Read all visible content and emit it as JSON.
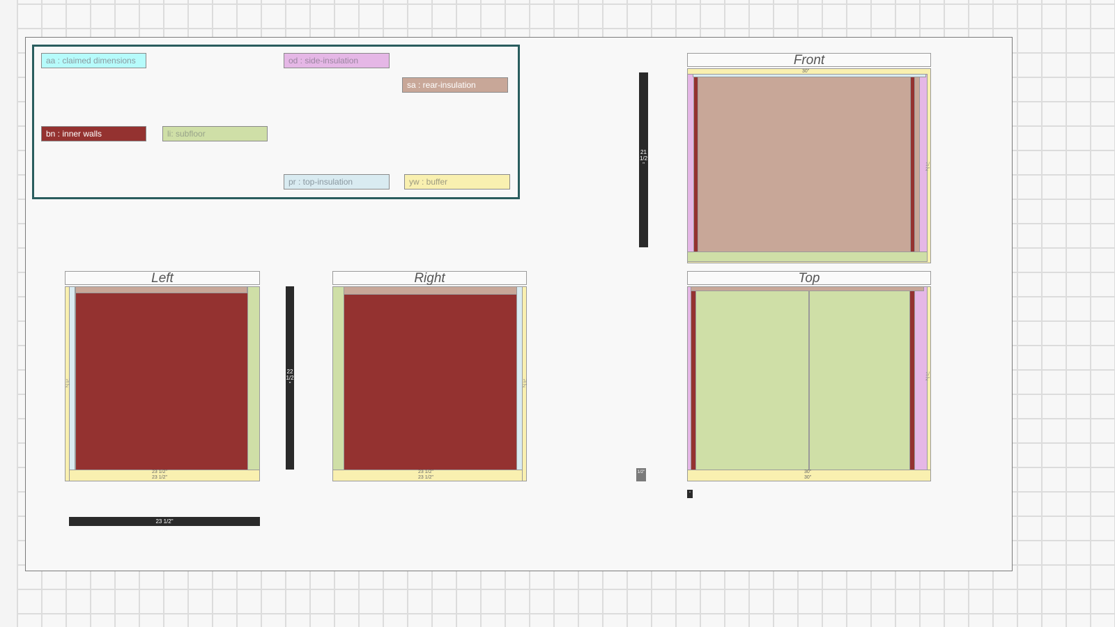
{
  "legend": {
    "items": [
      {
        "label": "aa : claimed dimensions",
        "color": "#b6fbfb",
        "text_color": "#8a9aa0"
      },
      {
        "label": "od : side-insulation",
        "color": "#e5b7e6",
        "text_color": "#9a85a0"
      },
      {
        "label": "sa : rear-insulation",
        "color": "#c8a798",
        "text_color": "#ffffff"
      },
      {
        "label": "bn : inner walls",
        "color": "#943230",
        "text_color": "#ffffff"
      },
      {
        "label": "li: subfloor",
        "color": "#cfdfa7",
        "text_color": "#98a38a"
      },
      {
        "label": "pr : top-insulation",
        "color": "#d9ebf1",
        "text_color": "#8a98a0"
      },
      {
        "label": "yw : buffer",
        "color": "#f9f0b0",
        "text_color": "#9c9a80"
      }
    ]
  },
  "views": {
    "front": {
      "title": "Front",
      "top_dim": "30\"",
      "side_dim": "1/2\""
    },
    "left": {
      "title": "Left",
      "bottom_dim_inner": "23 1/2\"",
      "bottom_dim_outer": "23 1/2\"",
      "side_dim": "1/2\""
    },
    "right": {
      "title": "Right",
      "bottom_dim_inner": "23 1/2\"",
      "bottom_dim_outer": "23 1/2\"",
      "side_dim": "1/2\""
    },
    "top": {
      "title": "Top",
      "bottom_dim_inner": "30\"",
      "bottom_dim_outer": "30\"",
      "side_dim": "1/2\""
    }
  },
  "dimensions": {
    "front_height": "21 1/2\"",
    "left_height": "22 1/2\"",
    "left_width": "23 1/2\"",
    "small_marker": "1/2\"",
    "tiny_marker": "\""
  },
  "colors": {
    "inner_walls": "#943230",
    "rear_insulation": "#c8a798",
    "side_insulation": "#e5b7e6",
    "subfloor": "#cfdfa7",
    "top_insulation": "#d9ebf1",
    "buffer": "#f9f0b0",
    "frame": "#2a5d5e"
  }
}
